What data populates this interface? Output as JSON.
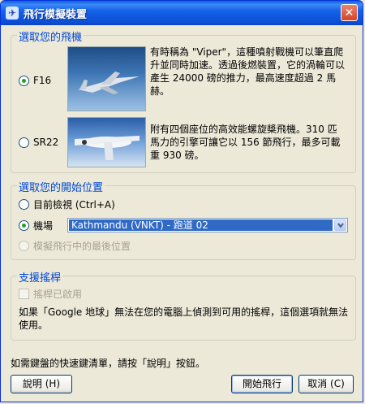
{
  "window": {
    "title": "飛行模擬裝置"
  },
  "aircraft_group": {
    "label": "選取您的飛機",
    "f16": {
      "name": "F16",
      "description": "有時稱為 \"Viper\"，這種噴射戰機可以筆直爬升並同時加速。透過後燃裝置，它的渦輪可以產生 24000 磅的推力，最高速度超過 2 馬赫。"
    },
    "sr22": {
      "name": "SR22",
      "description": "附有四個座位的高效能螺旋槳飛機。310 匹馬力的引擎可讓它以 156 節飛行，最多可載重 930 磅。"
    }
  },
  "start_group": {
    "label": "選取您的開始位置",
    "current_view": "目前檢視 (Ctrl+A)",
    "airport": "機場",
    "airport_value": "Kathmandu (VNKT) - 跑道 02",
    "last_position": "模擬飛行中的最後位置"
  },
  "joystick_group": {
    "label": "支援搖桿",
    "enabled": "搖桿已啟用",
    "note": "如果「Google 地球」無法在您的電腦上偵測到可用的搖桿，這個選項就無法使用。"
  },
  "footer": {
    "hint": "如需鍵盤的快速鍵清單，請按「說明」按鈕。",
    "help_button": "說明 (H)",
    "start_button": "開始飛行",
    "cancel_button": "取消 (C)"
  }
}
